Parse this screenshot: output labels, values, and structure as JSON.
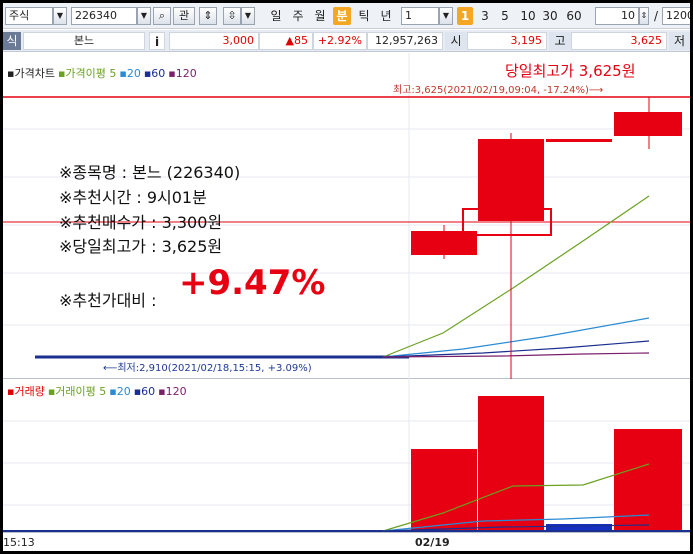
{
  "toolbar": {
    "market": "주식",
    "code": "226340",
    "search_icon": "search-icon",
    "kwan": "관",
    "periods": [
      "일",
      "주",
      "월",
      "분",
      "틱",
      "년"
    ],
    "active_period": "분",
    "unit_value": "1",
    "minute_steps": [
      "1",
      "3",
      "5",
      "10",
      "30",
      "60"
    ],
    "active_step": "1",
    "count_value": "10",
    "slash": "/",
    "total_value": "1200"
  },
  "quote": {
    "left_label": "식",
    "name": "본느",
    "info": "i",
    "price": "3,000",
    "change": "▲85",
    "change_pct": "+2.92%",
    "volume": "12,957,263",
    "open_label": "시",
    "open": "3,195",
    "high_label": "고",
    "high": "3,625",
    "low_label": "저"
  },
  "price_pane": {
    "legend": [
      {
        "text": "가격차트",
        "color": "#222222"
      },
      {
        "text": "가격이평 5",
        "color": "#6aa121"
      },
      {
        "text": "20",
        "color": "#2a8bd4"
      },
      {
        "text": "60",
        "color": "#1b2f8f"
      },
      {
        "text": "120",
        "color": "#7a1f6a"
      }
    ],
    "high_title": "당일최고가 3,625원",
    "high_note": "최고:3,625(2021/02/19,09:04, -17.24%)⟶",
    "low_note": "⟵최저:2,910(2021/02/18,15:15, +3.09%)"
  },
  "annotation": {
    "line1": "※종목명 : 본느 (226340)",
    "line2": "※추천시간 : 9시01분",
    "line3": "※추천매수가 : 3,300원",
    "line4": "※당일최고가 : 3,625원",
    "line5_label": "※추천가대비 :",
    "line5_value": "+9.47%"
  },
  "volume_pane": {
    "legend": [
      {
        "text": "거래량",
        "color": "#e00000"
      },
      {
        "text": "거래이평 5",
        "color": "#6aa121"
      },
      {
        "text": "20",
        "color": "#2a8bd4"
      },
      {
        "text": "60",
        "color": "#1b2f8f"
      },
      {
        "text": "120",
        "color": "#7a1f6a"
      }
    ]
  },
  "xaxis": {
    "left_time": "15:13",
    "date_label": "02/19"
  },
  "colors": {
    "up": "#e60012",
    "ma5": "#6aa121",
    "ma20": "#2a8bd4",
    "ma60": "#1b2f8f",
    "ma120": "#7a1f6a",
    "active": "#f5a623"
  }
}
